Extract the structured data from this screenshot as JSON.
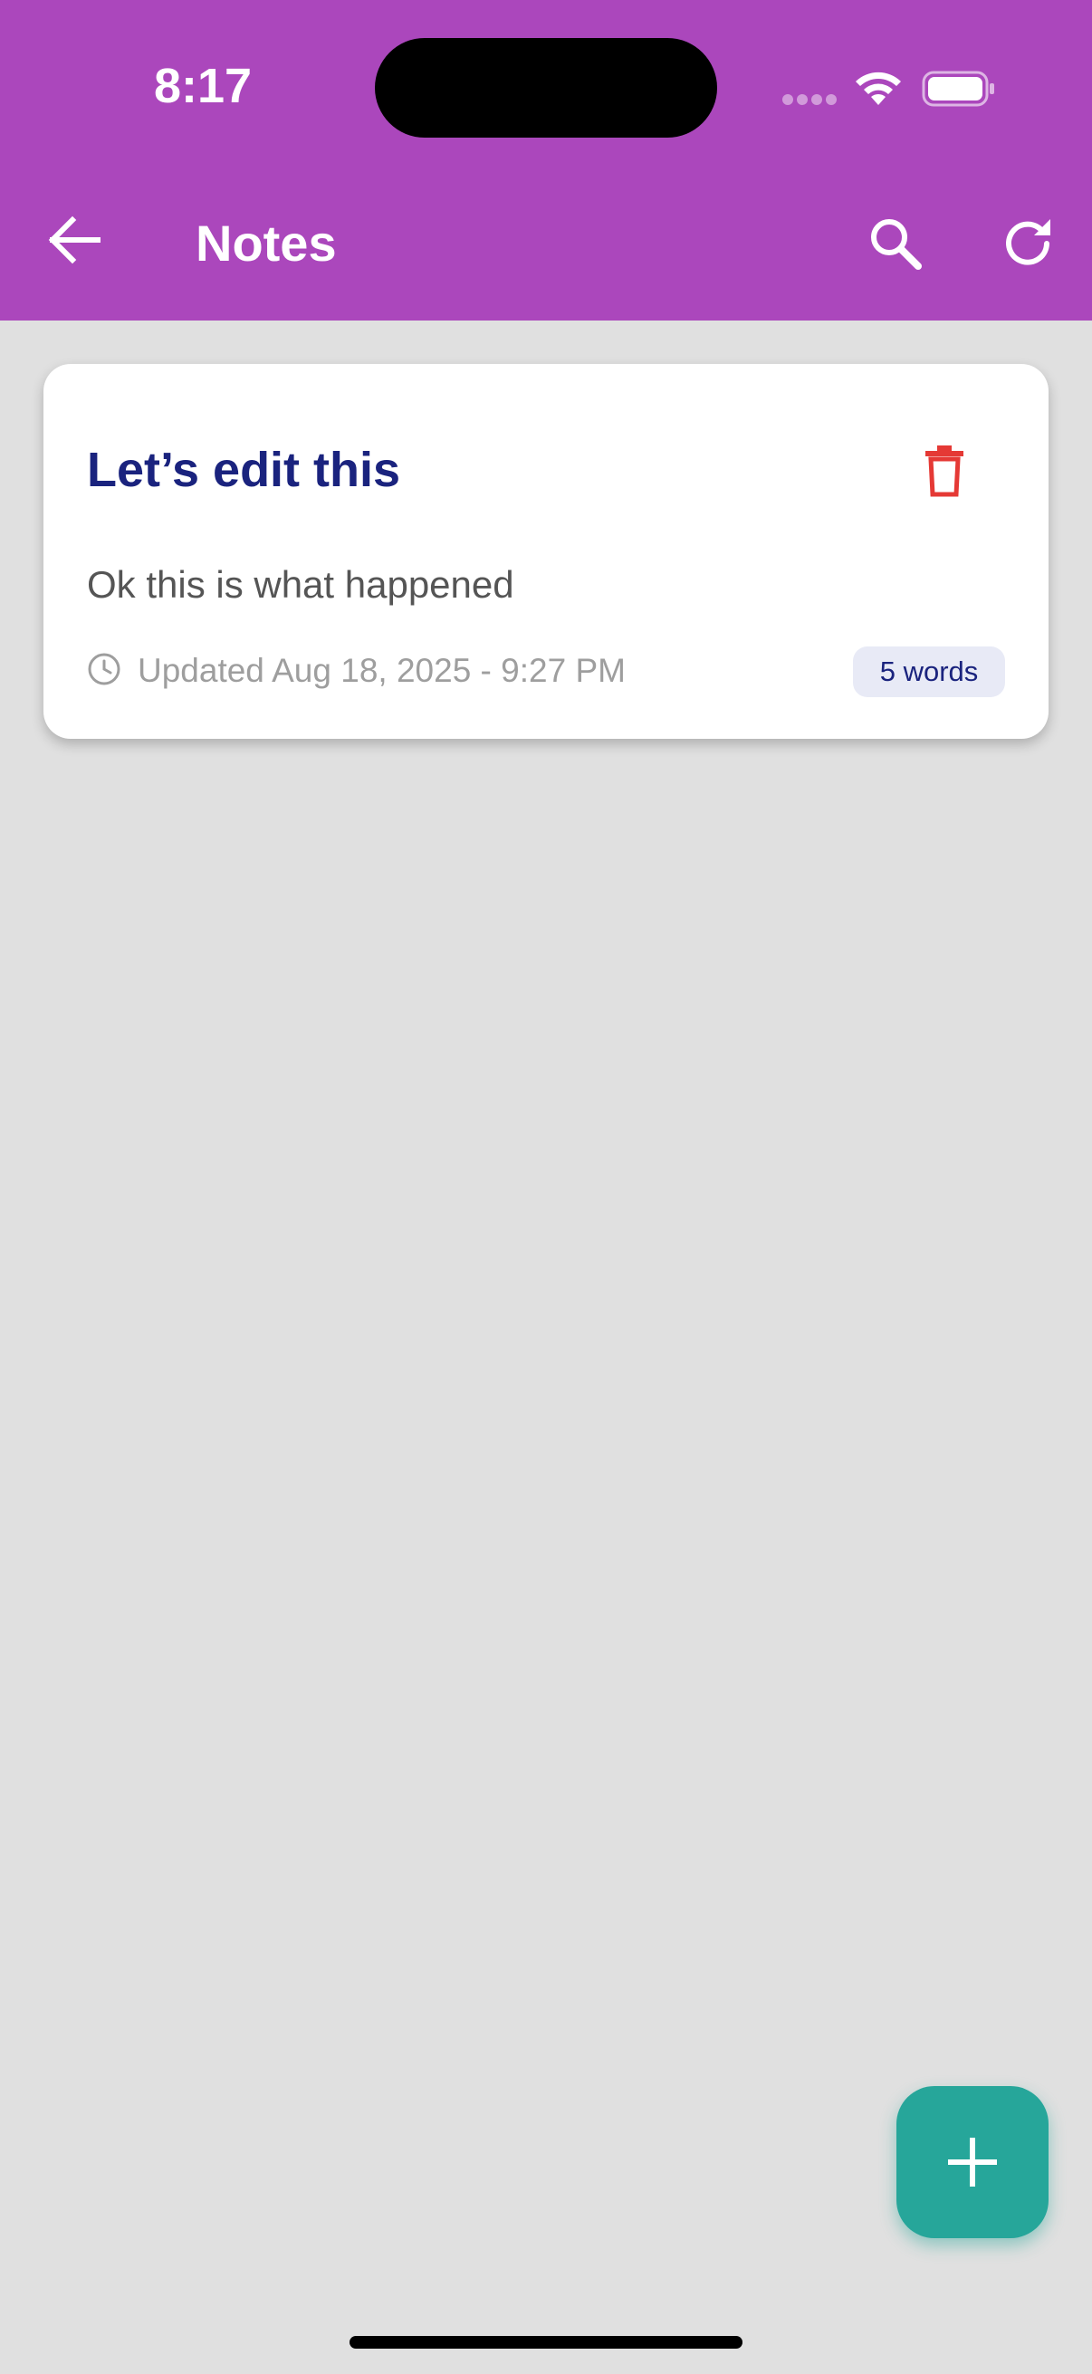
{
  "status_bar": {
    "time": "8:17"
  },
  "app_bar": {
    "title": "Notes",
    "icons": [
      "arrow-back-icon",
      "search-icon",
      "refresh-icon"
    ]
  },
  "notes": [
    {
      "title": "Let’s edit this",
      "body": "Ok this is what happened",
      "updated": "Updated Aug 18, 2025 - 9:27 PM",
      "word_count": "5 words"
    }
  ],
  "colors": {
    "app_bar": "#ab47bc",
    "background": "#e0e0e0",
    "title": "#1a237e",
    "delete": "#e53935",
    "fab": "#26a69a"
  }
}
